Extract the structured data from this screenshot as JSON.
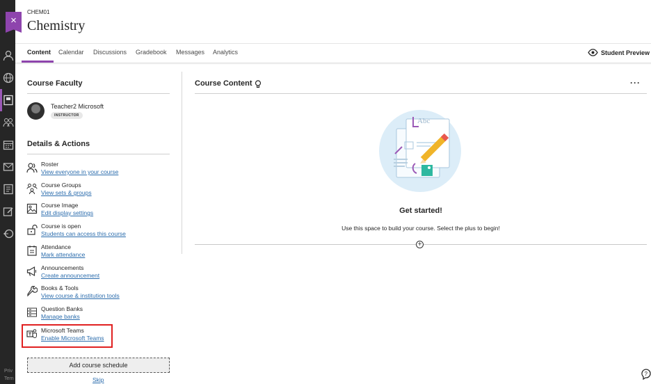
{
  "course": {
    "code": "CHEM01",
    "title": "Chemistry",
    "close_icon": "close-icon"
  },
  "tabs": [
    {
      "label": "Content",
      "active": true
    },
    {
      "label": "Calendar",
      "active": false
    },
    {
      "label": "Discussions",
      "active": false
    },
    {
      "label": "Gradebook",
      "active": false
    },
    {
      "label": "Messages",
      "active": false
    },
    {
      "label": "Analytics",
      "active": false
    }
  ],
  "student_preview": {
    "label": "Student Preview",
    "icon": "eye-icon"
  },
  "faculty": {
    "heading": "Course Faculty",
    "name": "Teacher2 Microsoft",
    "role": "INSTRUCTOR"
  },
  "details": {
    "heading": "Details & Actions",
    "items": [
      {
        "title": "Roster",
        "link": "View everyone in your course",
        "icon": "roster-icon"
      },
      {
        "title": "Course Groups",
        "link": "View sets & groups",
        "icon": "groups-icon"
      },
      {
        "title": "Course Image",
        "link": "Edit display settings",
        "icon": "image-icon"
      },
      {
        "title": "Course is open",
        "link": "Students can access this course",
        "icon": "unlock-icon"
      },
      {
        "title": "Attendance",
        "link": "Mark attendance",
        "icon": "attendance-icon"
      },
      {
        "title": "Announcements",
        "link": "Create announcement",
        "icon": "megaphone-icon"
      },
      {
        "title": "Books & Tools",
        "link": "View course & institution tools",
        "icon": "wrench-icon"
      },
      {
        "title": "Question Banks",
        "link": "Manage banks",
        "icon": "question-banks-icon"
      },
      {
        "title": "Microsoft Teams",
        "link": "Enable Microsoft Teams",
        "icon": "teams-icon"
      }
    ],
    "schedule_button": "Add course schedule",
    "skip_link": "Skip"
  },
  "content": {
    "heading": "Course Content",
    "illustration_text": "Abc",
    "empty_title": "Get started!",
    "empty_subtitle": "Use this space to build your course. Select the plus to begin!",
    "add_symbol": "+"
  },
  "rail_footer": [
    "Priv",
    "Tern"
  ],
  "colors": {
    "accent": "#8e44ad",
    "link": "#2c6dad",
    "highlight": "#e02020",
    "rail": "#262626"
  }
}
